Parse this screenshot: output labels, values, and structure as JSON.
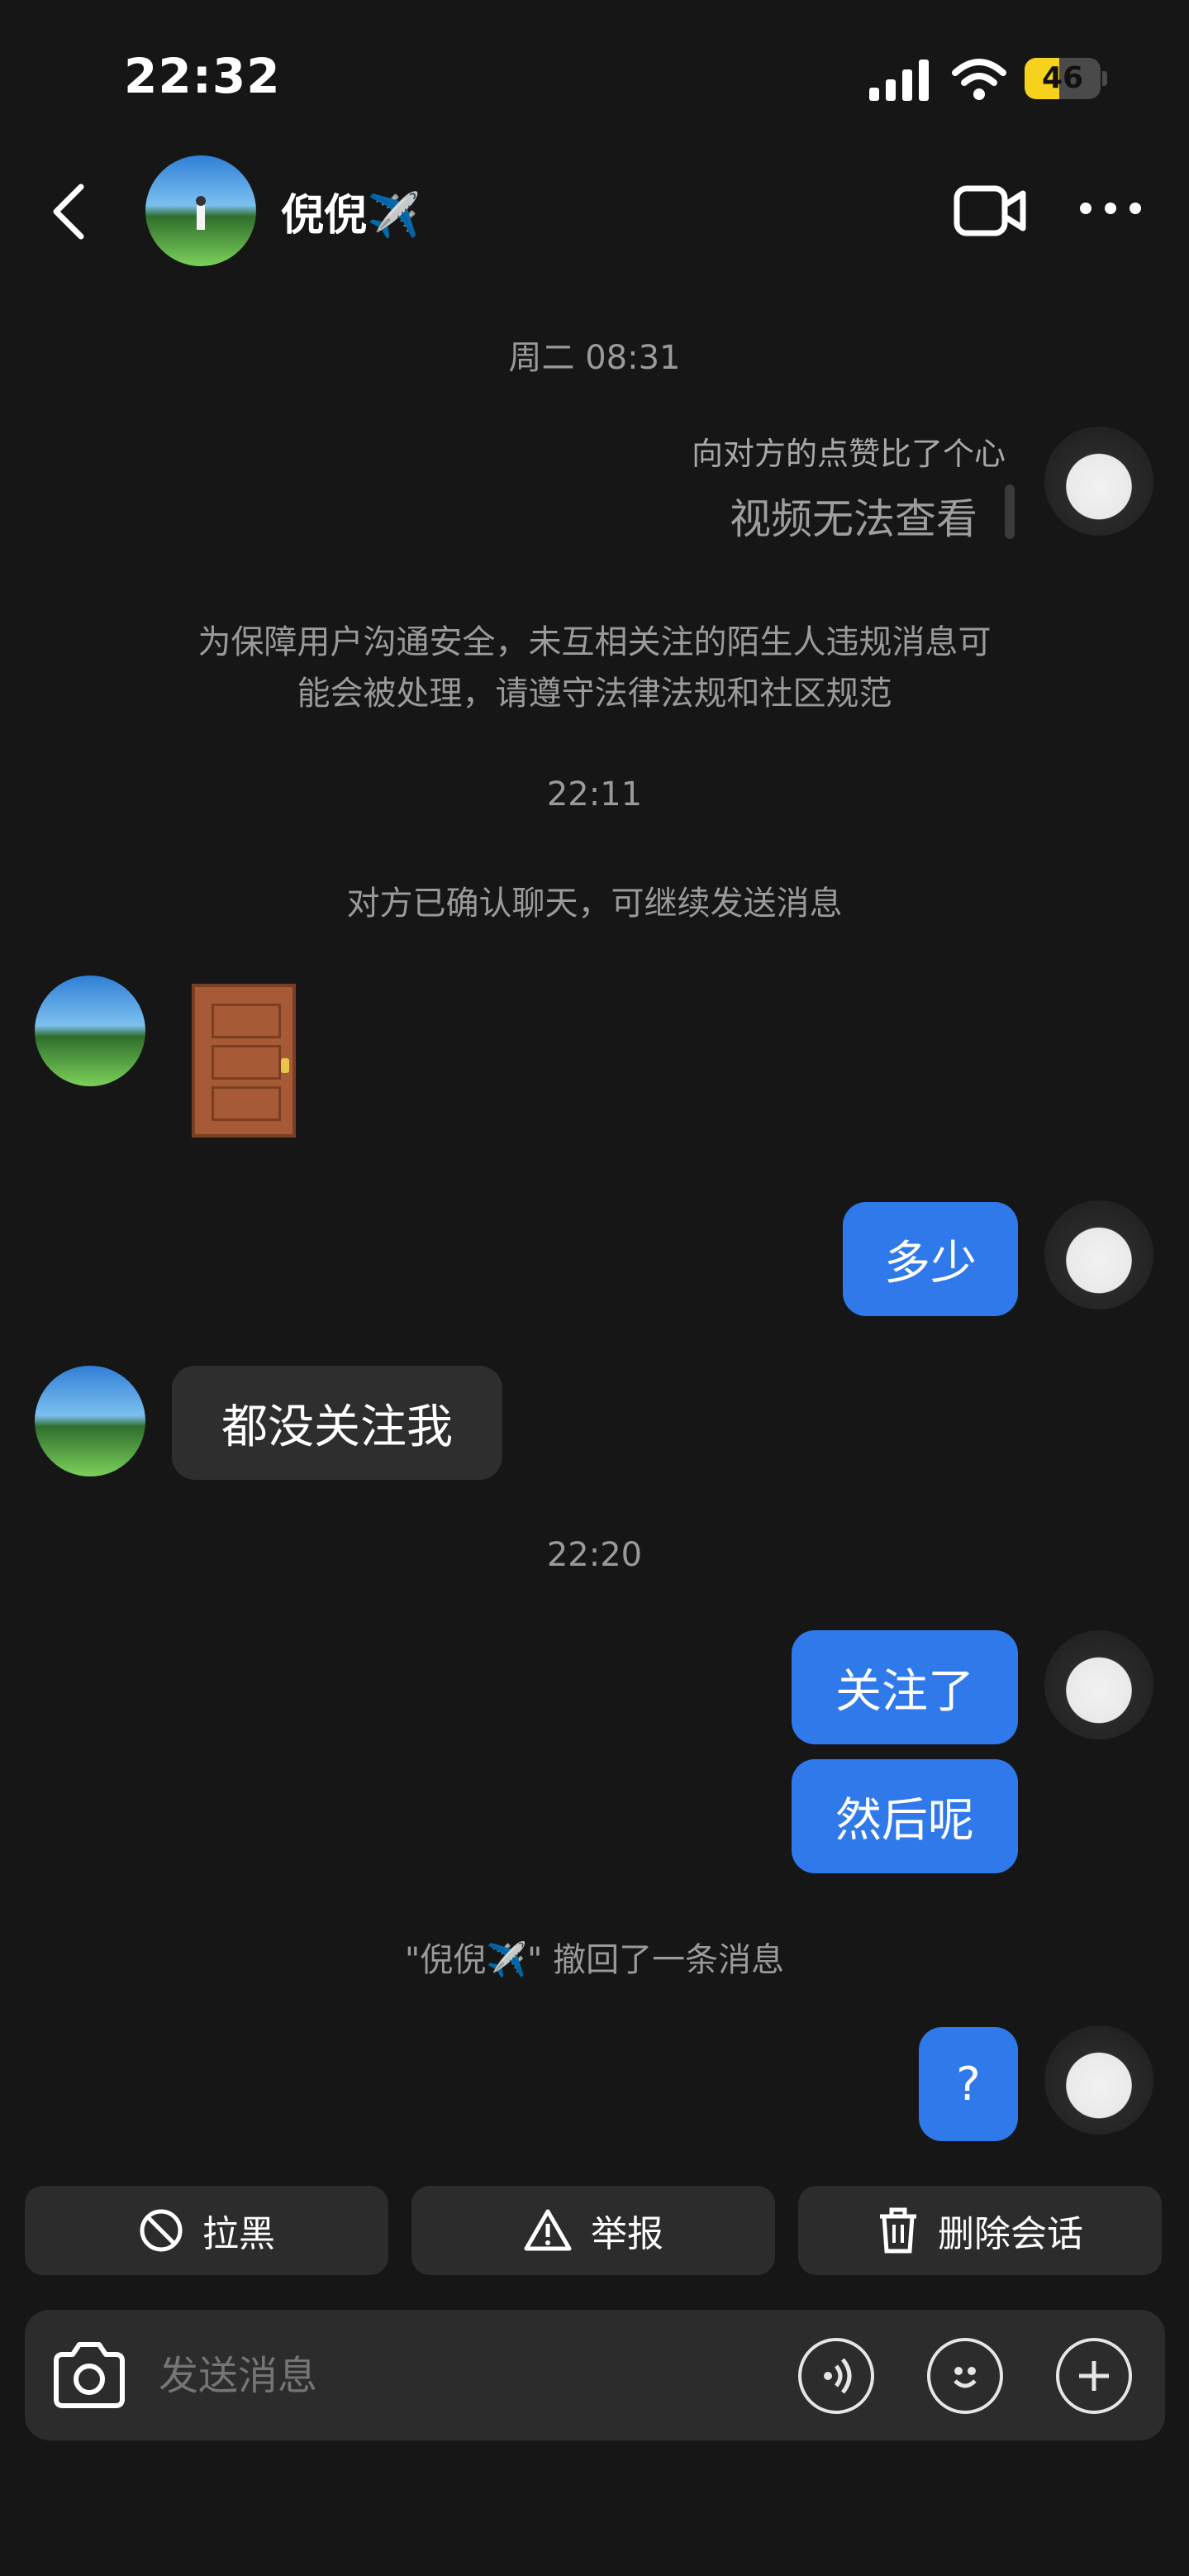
{
  "status_bar": {
    "time": "22:32",
    "battery": "46",
    "battery_level": 0.46
  },
  "header": {
    "contact_name": "倪倪✈️"
  },
  "messages": {
    "ts1": "周二 08:31",
    "like_note": "向对方的点赞比了个心",
    "video_unavailable": "视频无法查看",
    "safety_notice_line1": "为保障用户沟通安全，未互相关注的陌生人违规消息可",
    "safety_notice_line2": "能会被处理，请遵守法律法规和社区规范",
    "ts2": "22:11",
    "confirm_notice": "对方已确认聊天，可继续发送消息",
    "door_emoji": "🚪",
    "msg_duoshao": "多少",
    "msg_doumei": "都没关注我",
    "ts3": "22:20",
    "msg_guanzhu": "关注了",
    "msg_ranhou": "然后呢",
    "recall_notice": "\"倪倪✈️\" 撤回了一条消息",
    "msg_question": "?"
  },
  "actions": {
    "block": "拉黑",
    "report": "举报",
    "delete": "删除会话"
  },
  "input": {
    "placeholder": "发送消息"
  },
  "colors": {
    "accent_blue": "#2f79ea",
    "background": "#161616",
    "bubble_gray": "#2e2e2e"
  }
}
